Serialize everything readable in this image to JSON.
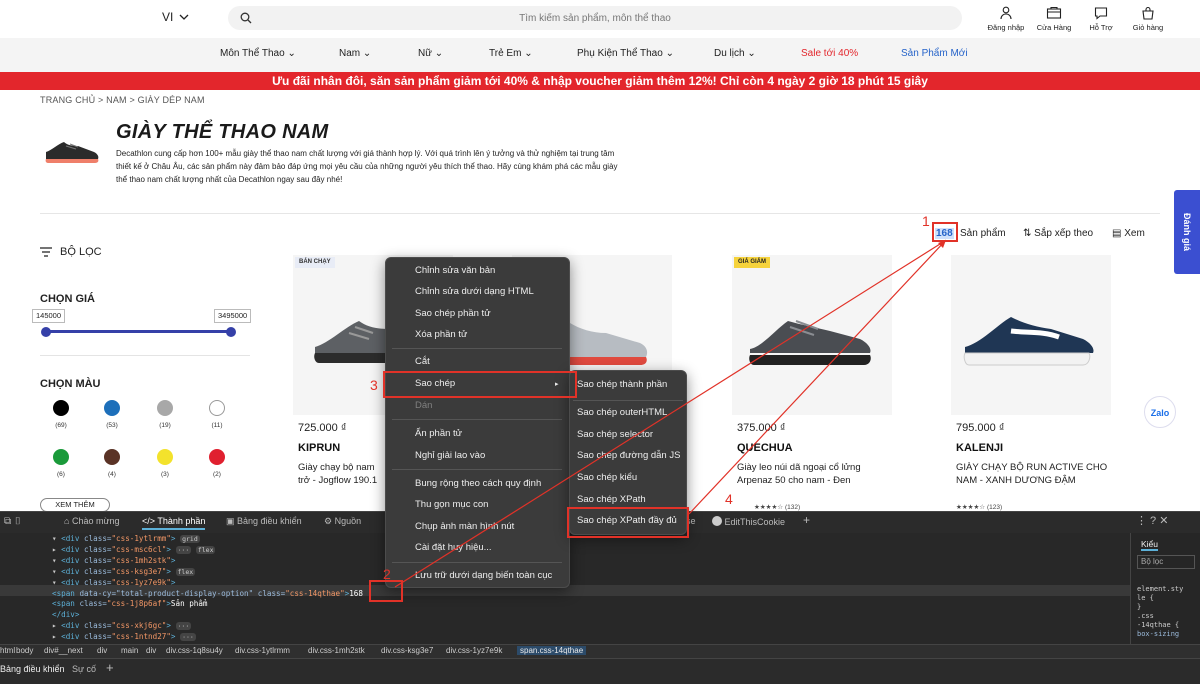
{
  "header": {
    "lang": "VI",
    "search_placeholder": "Tìm kiếm sản phẩm, môn thể thao",
    "icons": [
      {
        "label": "Đăng nhập",
        "icon": "user-icon"
      },
      {
        "label": "Cửa Hàng",
        "icon": "store-icon"
      },
      {
        "label": "Hỗ Trợ",
        "icon": "chat-icon"
      },
      {
        "label": "Giỏ hàng",
        "icon": "cart-icon"
      }
    ]
  },
  "nav": [
    "Môn Thể Thao",
    "Nam",
    "Nữ",
    "Trẻ Em",
    "Phụ Kiện Thể Thao",
    "Du lịch",
    "Sale tới 40%",
    "Sản Phẩm Mới"
  ],
  "colors": {
    "promo": "#e3262c",
    "sale": "#e3262c",
    "new": "#2563c9",
    "accent": "#3b4fd1",
    "annot": "#e13228"
  },
  "promo": "Ưu đãi nhân đôi, săn sản phẩm giảm tới 40% & nhập voucher giảm thêm 12%! Chỉ còn 4 ngày 2 giờ 18 phút 15 giây",
  "breadcrumb": "TRANG CHỦ  >  NAM  >  GIÀY DÉP NAM",
  "page": {
    "title": "GIÀY THỂ THAO NAM",
    "desc": "Decathlon cung cấp hơn 100+ mẫu giày thể thao nam chất lượng với giá thành hợp lý. Với quá trình lên ý tưởng và thử nghiệm tại trung tâm thiết kế ở Châu Âu, các sản phẩm này đảm bảo đáp ứng mọi yêu cầu của những người yêu thích thể thao. Hãy cùng khám phá các mẫu giày thể thao nam chất lượng nhất của Decathlon ngay sau đây nhé!"
  },
  "toolbar": {
    "count": "168",
    "count_label": "Sản phẩm",
    "sort": "Sắp xếp theo",
    "view": "Xem"
  },
  "review_tab": "Đánh giá",
  "filter": {
    "title": "BỘ LỌC",
    "price_title": "CHỌN GIÁ",
    "min": "145000",
    "max": "3495000",
    "color_title": "CHỌN MÀU",
    "colors": [
      {
        "hex": "#000000",
        "count": "(69)"
      },
      {
        "hex": "#1d6fba",
        "count": "(53)"
      },
      {
        "hex": "#a8a8a8",
        "count": "(19)"
      },
      {
        "hex": "#ffffff",
        "count": "(11)"
      },
      {
        "hex": "#1a9a3a",
        "count": "(6)"
      },
      {
        "hex": "#5a3326",
        "count": "(4)"
      },
      {
        "hex": "#f3e22c",
        "count": "(3)"
      },
      {
        "hex": "#e0202f",
        "count": "(2)"
      }
    ],
    "more": "XEM THÊM"
  },
  "products": [
    {
      "badge": "BÁN CHẠY",
      "price": "725.000 ₫",
      "brand": "KIPRUN",
      "name": "Giày chạy bộ nam trở - Jogflow 190.1 xám",
      "rating": ""
    },
    {
      "badge": "",
      "price": "",
      "brand": "",
      "name": "",
      "rating": ""
    },
    {
      "badge": "GIÁ GIẢM",
      "price": "375.000 ₫",
      "brand": "QUECHUA",
      "name": "Giày leo núi dã ngoại cổ lửng Arpenaz 50 cho nam - Đen",
      "rating": "★★★★☆ (132)"
    },
    {
      "badge": "",
      "price": "795.000 ₫",
      "brand": "KALENJI",
      "name": "GIÀY CHẠY BỘ RUN ACTIVE CHO NAM - XANH DƯƠNG ĐẬM",
      "rating": "★★★★☆ (123)"
    }
  ],
  "zalo": "Zalo",
  "devtools": {
    "tabs": [
      "Chào mừng",
      "Thành phần",
      "Bảng điều khiển",
      "Nguồn",
      "se",
      "EditThisCookie"
    ],
    "styles_tab": "Kiểu",
    "filter": "Bộ lọc",
    "code": [
      {
        "indent": "▾ ",
        "tag": "div",
        "cls": "css-1ytlrmm",
        "pill": "grid"
      },
      {
        "indent": "  ▸ ",
        "tag": "div",
        "cls": "css-msc6cl",
        "pill": "flex"
      },
      {
        "indent": "  ▾ ",
        "tag": "div",
        "cls": "css-1mh2stk",
        "pill": ""
      },
      {
        "indent": "    ▾ ",
        "tag": "div",
        "cls": "css-ksg3e7",
        "pill": "flex"
      },
      {
        "indent": "      ▾ ",
        "tag": "div",
        "cls": "css-1yz7e9k",
        "pill": ""
      },
      {
        "indent": "        ",
        "tag": "span",
        "cls": "css-14qthae",
        "pill": ""
      },
      {
        "indent": "        ",
        "tag": "span",
        "cls": "css-1j8p6af",
        "pill": ""
      },
      {
        "indent": "      ",
        "tag": "/div",
        "cls": "",
        "pill": ""
      },
      {
        "indent": "    ▸ ",
        "tag": "div",
        "cls": "css-xkj6gc",
        "pill": ""
      },
      {
        "indent": "    ▸ ",
        "tag": "div",
        "cls": "css-1ntnd27",
        "pill": ""
      },
      {
        "indent": "    ▸ ",
        "tag": "div",
        "cls": "css-1ntnd27",
        "pill": ""
      }
    ],
    "selected_attr": "data-cy=\"total-product-display-option\"",
    "selected_text": "168",
    "second_text": "Sản phẩm",
    "breadcrumb": [
      "html",
      "body",
      "div#__next",
      "div",
      "main",
      "div",
      "div.css-1q8su4y",
      "div.css-1ytlrmm",
      "div.css-1mh2stk",
      "div.css-ksg3e7",
      "div.css-1yz7e9k",
      "span.css-14qthae"
    ],
    "bottom_tabs": [
      "Bảng điều khiển",
      "Sự cố"
    ],
    "style_lines": [
      "element.sty",
      "le {",
      "}",
      ".css",
      "-14qthae {",
      "box-sizing"
    ]
  },
  "context_menu": {
    "items": [
      "Chỉnh sửa văn bản",
      "Chỉnh sửa dưới dạng HTML",
      "Sao chép phần tử",
      "Xóa phần tử",
      "Cắt",
      "Sao chép",
      "Dán",
      "Ẩn phần tử",
      "Nghỉ giải lao vào",
      "Bung rộng theo cách quy định",
      "Thu gọn mục con",
      "Chụp ảnh màn hình nút",
      "Cài đặt huy hiệu...",
      "Lưu trữ dưới dạng biến toàn cục"
    ],
    "submenu": [
      "Sao chép thành phần",
      "Sao chép outerHTML",
      "Sao chép selector",
      "Sao chép đường dẫn JS",
      "Sao chép kiểu",
      "Sao chép XPath",
      "Sao chép XPath đầy đủ"
    ]
  },
  "annotations": [
    "1",
    "2",
    "3",
    "4"
  ]
}
